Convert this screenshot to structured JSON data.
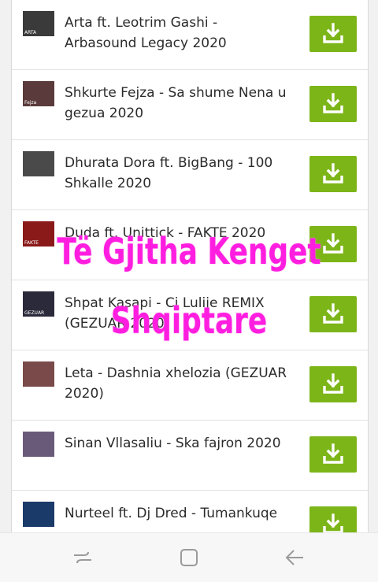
{
  "songs": [
    {
      "title": "Arta ft. Leotrim Gashi - Arbasound Legacy 2020",
      "thumb_color": "#3a3a3a",
      "thumb_label": "ARTA"
    },
    {
      "title": "Shkurte Fejza - Sa shume Nena u gezua 2020",
      "thumb_color": "#5a3a3a",
      "thumb_label": "Fejza"
    },
    {
      "title": "Dhurata Dora ft. BigBang - 100 Shkalle 2020",
      "thumb_color": "#4a4a4a",
      "thumb_label": ""
    },
    {
      "title": "Duda ft. Unittick - FAKTE 2020",
      "thumb_color": "#8a1a1a",
      "thumb_label": "FAKTE"
    },
    {
      "title": "Shpat Kasapi - Ci Lulije REMIX (GEZUAR 2020)",
      "thumb_color": "#2a2a3a",
      "thumb_label": "GEZUAR"
    },
    {
      "title": "Leta - Dashnia xhelozia (GEZUAR 2020)",
      "thumb_color": "#7a4a4a",
      "thumb_label": ""
    },
    {
      "title": "Sinan Vllasaliu - Ska fajron 2020",
      "thumb_color": "#6a5a7a",
      "thumb_label": ""
    },
    {
      "title": "Nurteel ft. Dj Dred - Tumankuqe",
      "thumb_color": "#1a3a6a",
      "thumb_label": ""
    }
  ],
  "overlay": {
    "line1": "Të Gjitha Kenget",
    "line2": "Shqiptare",
    "color": "#ff1ee0"
  },
  "accent": "#7cb518",
  "icons": {
    "download": "download-icon",
    "recents": "recents-icon",
    "home": "home-icon",
    "back": "back-icon"
  }
}
